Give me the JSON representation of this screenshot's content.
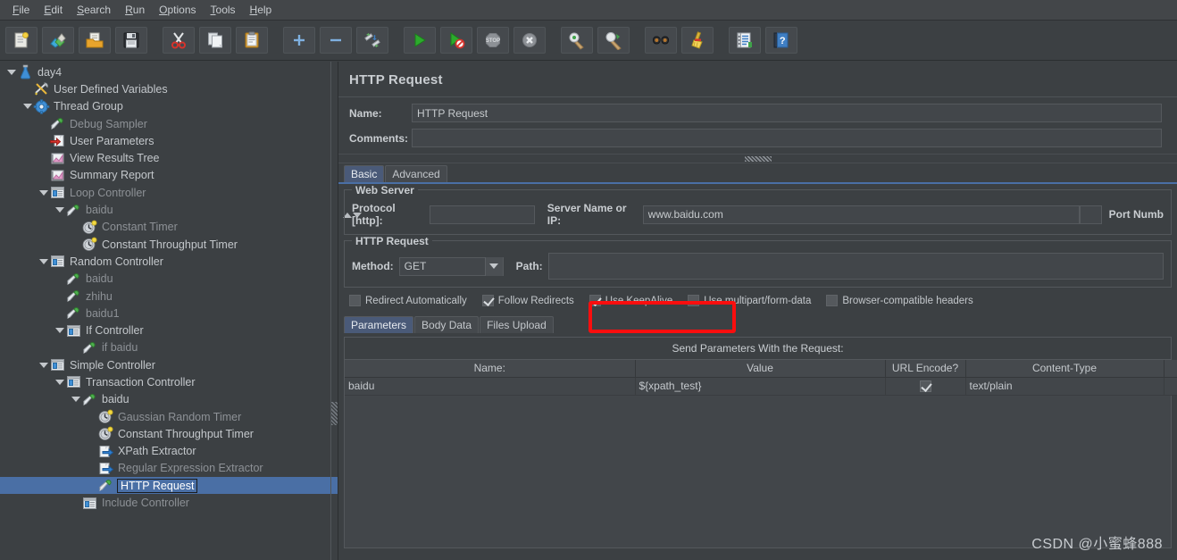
{
  "app": {
    "window_title": "HTTP Request",
    "watermark": "CSDN @小蜜蜂888"
  },
  "menubar": {
    "items": [
      {
        "label": "File",
        "mnemonic": "F"
      },
      {
        "label": "Edit",
        "mnemonic": "E"
      },
      {
        "label": "Search",
        "mnemonic": "S"
      },
      {
        "label": "Run",
        "mnemonic": "R"
      },
      {
        "label": "Options",
        "mnemonic": "O"
      },
      {
        "label": "Tools",
        "mnemonic": "T"
      },
      {
        "label": "Help",
        "mnemonic": "H"
      }
    ]
  },
  "toolbar": {
    "buttons": [
      {
        "name": "new-icon",
        "title": "New"
      },
      {
        "name": "templates-icon",
        "title": "Templates"
      },
      {
        "name": "open-icon",
        "title": "Open"
      },
      {
        "name": "save-icon",
        "title": "Save Test Plan"
      },
      {
        "name": "cut-icon",
        "title": "Cut"
      },
      {
        "name": "copy-icon",
        "title": "Copy"
      },
      {
        "name": "paste-icon",
        "title": "Paste"
      },
      {
        "name": "expand-all-icon",
        "title": "Expand All"
      },
      {
        "name": "collapse-all-icon",
        "title": "Collapse All"
      },
      {
        "name": "toggle-icon",
        "title": "Toggle"
      },
      {
        "name": "start-icon",
        "title": "Start"
      },
      {
        "name": "start-no-pauses-icon",
        "title": "Start no pauses"
      },
      {
        "name": "stop-icon",
        "title": "Stop"
      },
      {
        "name": "shutdown-icon",
        "title": "Shutdown"
      },
      {
        "name": "clear-icon",
        "title": "Clear"
      },
      {
        "name": "clear-all-icon",
        "title": "Clear All"
      },
      {
        "name": "search-icon",
        "title": "Search"
      },
      {
        "name": "reset-search-icon",
        "title": "Reset Search"
      },
      {
        "name": "function-helper-icon",
        "title": "Function Helper Dialog"
      },
      {
        "name": "help-icon",
        "title": "Help"
      }
    ]
  },
  "tree": {
    "items": [
      {
        "label": "day4",
        "indent": 0,
        "icon": "test-plan-icon",
        "twisty": true,
        "dim": false,
        "selected": false
      },
      {
        "label": "User Defined Variables",
        "indent": 1,
        "icon": "config-element-icon",
        "twisty": false,
        "dim": false,
        "selected": false
      },
      {
        "label": "Thread Group",
        "indent": 1,
        "icon": "thread-group-icon",
        "twisty": true,
        "dim": false,
        "selected": false
      },
      {
        "label": "Debug Sampler",
        "indent": 2,
        "icon": "sampler-icon",
        "twisty": false,
        "dim": true,
        "selected": false
      },
      {
        "label": "User Parameters",
        "indent": 2,
        "icon": "pre-processor-icon",
        "twisty": false,
        "dim": false,
        "selected": false
      },
      {
        "label": "View Results Tree",
        "indent": 2,
        "icon": "listener-icon",
        "twisty": false,
        "dim": false,
        "selected": false
      },
      {
        "label": "Summary Report",
        "indent": 2,
        "icon": "listener-icon",
        "twisty": false,
        "dim": false,
        "selected": false
      },
      {
        "label": "Loop Controller",
        "indent": 2,
        "icon": "controller-icon",
        "twisty": true,
        "dim": true,
        "selected": false
      },
      {
        "label": "baidu",
        "indent": 3,
        "icon": "sampler-icon",
        "twisty": true,
        "dim": true,
        "selected": false
      },
      {
        "label": "Constant Timer",
        "indent": 4,
        "icon": "timer-icon",
        "twisty": false,
        "dim": true,
        "selected": false
      },
      {
        "label": "Constant Throughput Timer",
        "indent": 4,
        "icon": "timer-icon",
        "twisty": false,
        "dim": false,
        "selected": false
      },
      {
        "label": "Random Controller",
        "indent": 2,
        "icon": "controller-icon",
        "twisty": true,
        "dim": false,
        "selected": false
      },
      {
        "label": "baidu",
        "indent": 3,
        "icon": "sampler-icon",
        "twisty": false,
        "dim": true,
        "selected": false
      },
      {
        "label": "zhihu",
        "indent": 3,
        "icon": "sampler-icon",
        "twisty": false,
        "dim": true,
        "selected": false
      },
      {
        "label": "baidu1",
        "indent": 3,
        "icon": "sampler-icon",
        "twisty": false,
        "dim": true,
        "selected": false
      },
      {
        "label": "If Controller",
        "indent": 3,
        "icon": "controller-icon",
        "twisty": true,
        "dim": false,
        "selected": false
      },
      {
        "label": "if baidu",
        "indent": 4,
        "icon": "sampler-icon",
        "twisty": false,
        "dim": true,
        "selected": false
      },
      {
        "label": "Simple Controller",
        "indent": 2,
        "icon": "controller-icon",
        "twisty": true,
        "dim": false,
        "selected": false
      },
      {
        "label": "Transaction Controller",
        "indent": 3,
        "icon": "controller-icon",
        "twisty": true,
        "dim": false,
        "selected": false
      },
      {
        "label": "baidu",
        "indent": 4,
        "icon": "sampler-icon",
        "twisty": true,
        "dim": false,
        "selected": false
      },
      {
        "label": "Gaussian Random Timer",
        "indent": 5,
        "icon": "timer-icon",
        "twisty": false,
        "dim": true,
        "selected": false
      },
      {
        "label": "Constant Throughput Timer",
        "indent": 5,
        "icon": "timer-icon",
        "twisty": false,
        "dim": false,
        "selected": false
      },
      {
        "label": "XPath Extractor",
        "indent": 5,
        "icon": "post-processor-icon",
        "twisty": false,
        "dim": false,
        "selected": false
      },
      {
        "label": "Regular Expression Extractor",
        "indent": 5,
        "icon": "post-processor-icon",
        "twisty": false,
        "dim": true,
        "selected": false
      },
      {
        "label": "HTTP Request",
        "indent": 5,
        "icon": "sampler-icon",
        "twisty": false,
        "dim": false,
        "selected": true
      },
      {
        "label": "Include Controller",
        "indent": 4,
        "icon": "controller-icon",
        "twisty": false,
        "dim": true,
        "selected": false
      }
    ]
  },
  "editor": {
    "title": "HTTP Request",
    "name_label": "Name:",
    "name_value": "HTTP Request",
    "comments_label": "Comments:",
    "comments_value": "",
    "tabs": [
      {
        "label": "Basic",
        "active": true
      },
      {
        "label": "Advanced",
        "active": false
      }
    ],
    "web_server": {
      "legend": "Web Server",
      "protocol_label": "Protocol [http]:",
      "protocol_value": "",
      "server_label": "Server Name or IP:",
      "server_value": "www.baidu.com",
      "port_label": "Port Numb"
    },
    "http_request": {
      "legend": "HTTP Request",
      "method_label": "Method:",
      "method_value": "GET",
      "path_label": "Path:",
      "path_value": ""
    },
    "checkboxes": [
      {
        "label": "Redirect Automatically",
        "checked": false
      },
      {
        "label": "Follow Redirects",
        "checked": true
      },
      {
        "label": "Use KeepAlive",
        "checked": true
      },
      {
        "label": "Use multipart/form-data",
        "checked": false
      },
      {
        "label": "Browser-compatible headers",
        "checked": false
      }
    ],
    "param_tabs": [
      {
        "label": "Parameters",
        "active": true
      },
      {
        "label": "Body Data",
        "active": false
      },
      {
        "label": "Files Upload",
        "active": false
      }
    ],
    "params": {
      "caption": "Send Parameters With the Request:",
      "columns": [
        "Name:",
        "Value",
        "URL Encode?",
        "Content-Type",
        ""
      ],
      "rows": [
        {
          "name": "baidu",
          "value": "${xpath_test}",
          "url_encode": true,
          "content_type": "text/plain",
          "include_equals": ""
        }
      ]
    }
  },
  "colors": {
    "window_bg": "#3c4043",
    "menubar_bg": "#434649",
    "selection_blue": "#4a6fa5",
    "tab_active": "#4a5a78",
    "field_bg": "#42464a",
    "border": "#54585c",
    "text": "#c3c7cb",
    "text_dim": "#8d9196",
    "annotation_red": "#fb0e0e"
  }
}
